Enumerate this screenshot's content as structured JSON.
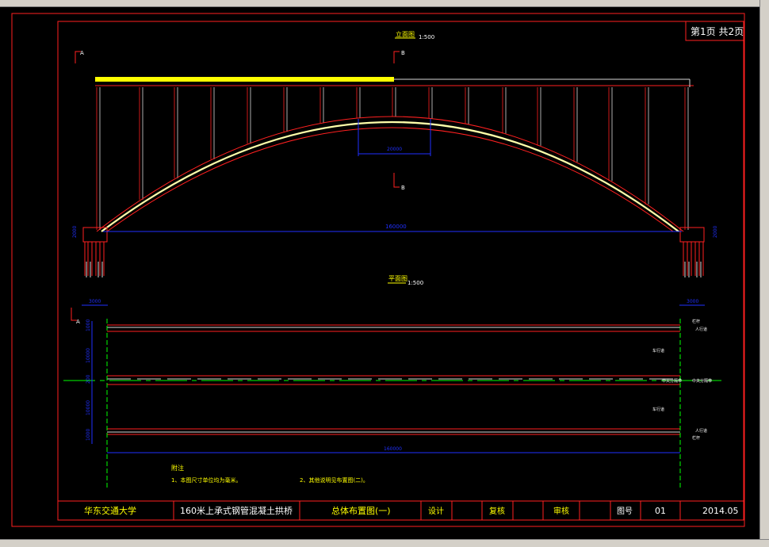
{
  "sheet": {
    "page_info": "第1页  共2页",
    "elevation_title": "立面图",
    "elevation_scale": "1:500",
    "plan_title": "平面图",
    "plan_scale": "1:500",
    "section_a": "A",
    "section_b": "B"
  },
  "dimensions": {
    "span": "160000",
    "crown_width": "20000",
    "plan_length": "160000",
    "pier_left": "2000",
    "pier_right": "2000",
    "foot_left": "3000",
    "foot_right": "3000",
    "plan_w1": "1000",
    "plan_w2": "10000",
    "plan_w3": "200",
    "plan_w4": "10000",
    "plan_w5": "1000"
  },
  "plan_labels": {
    "l1": "栏杆",
    "l2": "人行道",
    "l3": "车行道",
    "l4": "车行道",
    "l5": "中央分隔带",
    "l6": "人行道",
    "l7": "栏杆"
  },
  "notes": {
    "title": "附注",
    "item1": "1、本图尺寸单位均为毫米。",
    "item2": "2、其他说明见布置图(二)。"
  },
  "title_block": {
    "school": "华东交通大学",
    "project": "160米上承式钢管混凝土拱桥",
    "drawing_name": "总体布置图(一)",
    "design": "设计",
    "review": "复核",
    "approve": "审核",
    "drawing_no_label": "图号",
    "drawing_no": "01",
    "date": "2014.05"
  },
  "colors": {
    "frame": "#ff2020",
    "dimension": "#2030ff",
    "highlight": "#ffff00",
    "text": "#ffff00",
    "centerline": "#00ff00"
  }
}
